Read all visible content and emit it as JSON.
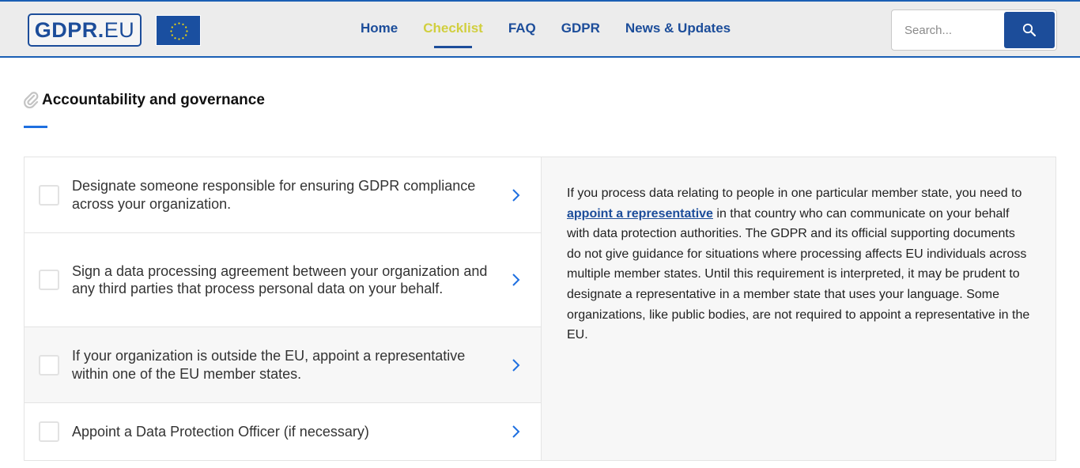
{
  "header": {
    "logo": {
      "bold": "GDPR.",
      "light": "EU"
    },
    "flag_icon": "eu-flag",
    "nav": [
      {
        "label": "Home",
        "active": false
      },
      {
        "label": "Checklist",
        "active": true
      },
      {
        "label": "FAQ",
        "active": false
      },
      {
        "label": "GDPR",
        "active": false
      },
      {
        "label": "News & Updates",
        "active": false
      }
    ],
    "search": {
      "placeholder": "Search...",
      "value": "",
      "button_icon": "search-icon"
    }
  },
  "section": {
    "icon": "paperclip-icon",
    "title": "Accountability and governance"
  },
  "checklist": {
    "items": [
      {
        "label": "Designate someone responsible for ensuring GDPR compliance across your organization.",
        "checked": false,
        "selected": false
      },
      {
        "label": "Sign a data processing agreement between your organization and any third parties that process personal data on your behalf.",
        "checked": false,
        "selected": false
      },
      {
        "label": "If your organization is outside the EU, appoint a representative within one of the EU member states.",
        "checked": false,
        "selected": true
      },
      {
        "label": "Appoint a Data Protection Officer (if necessary)",
        "checked": false,
        "selected": false
      }
    ]
  },
  "detail": {
    "before_link": "If you process data relating to people in one particular member state, you need to ",
    "link_text": "appoint a representative",
    "after_link": " in that country who can communicate on your behalf with data protection authorities. The GDPR and its official supporting documents do not give guidance for situations where processing affects EU individuals across multiple member states. Until this requirement is interpreted, it may be prudent to designate a representative in a member state that uses your language. Some organizations, like public bodies, are not required to appoint a representative in the EU."
  },
  "colors": {
    "brand_blue": "#1c4d9a",
    "active_nav": "#d1cf3f",
    "accent_blue": "#1e6fe0",
    "header_border": "#1a5fb4"
  }
}
